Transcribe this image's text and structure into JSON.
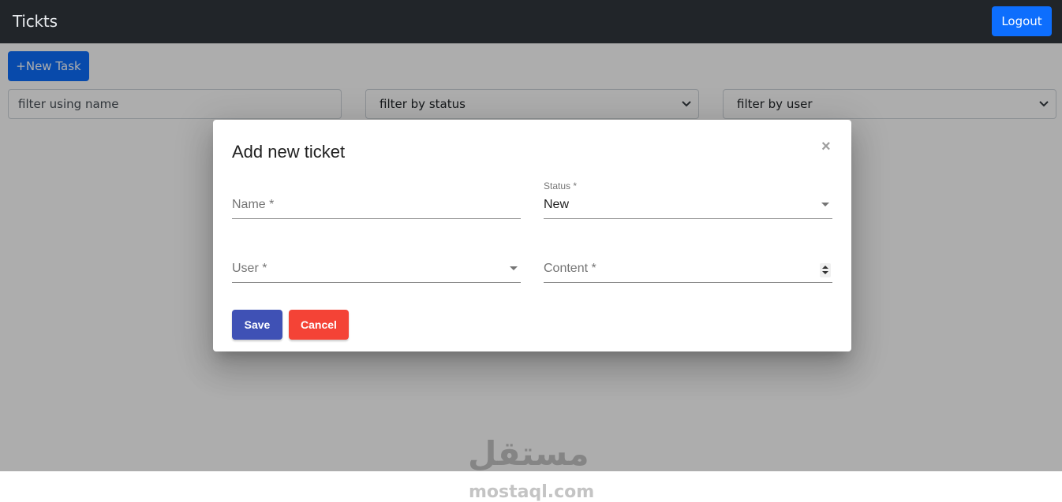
{
  "navbar": {
    "brand": "Tickts",
    "logout_label": "Logout"
  },
  "toolbar": {
    "new_task_label": "+New Task"
  },
  "filters": {
    "name_placeholder": "filter using name",
    "status_selected": "filter by status",
    "user_selected": "filter by user"
  },
  "modal": {
    "title": "Add new ticket",
    "close_glyph": "×",
    "name_label": "Name *",
    "status_label": "Status *",
    "status_value": "New",
    "user_label": "User *",
    "content_label": "Content *",
    "save_label": "Save",
    "cancel_label": "Cancel"
  },
  "watermark": {
    "arabic": "مستقل",
    "latin": "mostaql.com"
  },
  "colors": {
    "navbar_bg": "#212529",
    "primary": "#0d6efd",
    "save": "#3f51b5",
    "cancel": "#f44336"
  },
  "icons": {
    "dropdown": "chevron-down-icon",
    "close": "close-icon",
    "stepper": "stepper-icon"
  }
}
